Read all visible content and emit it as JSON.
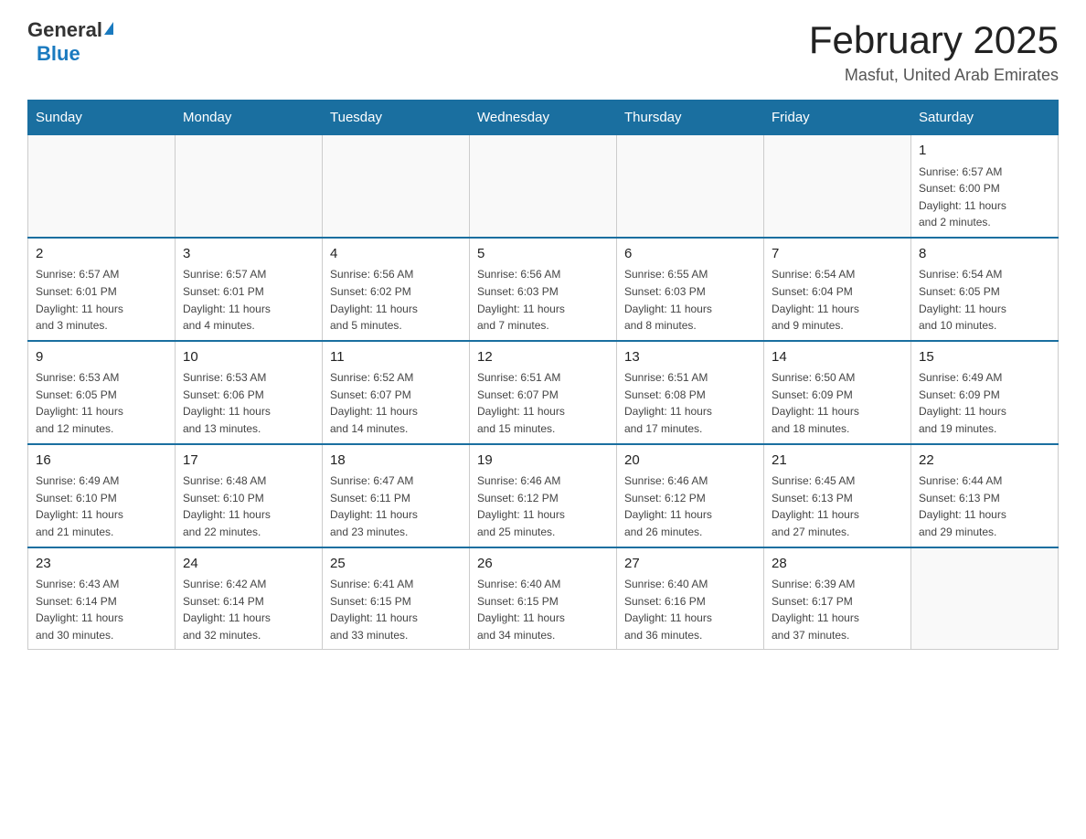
{
  "header": {
    "logo": {
      "general": "General",
      "blue": "Blue"
    },
    "title": "February 2025",
    "location": "Masfut, United Arab Emirates"
  },
  "days_of_week": [
    "Sunday",
    "Monday",
    "Tuesday",
    "Wednesday",
    "Thursday",
    "Friday",
    "Saturday"
  ],
  "weeks": [
    [
      {
        "day": "",
        "info": ""
      },
      {
        "day": "",
        "info": ""
      },
      {
        "day": "",
        "info": ""
      },
      {
        "day": "",
        "info": ""
      },
      {
        "day": "",
        "info": ""
      },
      {
        "day": "",
        "info": ""
      },
      {
        "day": "1",
        "info": "Sunrise: 6:57 AM\nSunset: 6:00 PM\nDaylight: 11 hours\nand 2 minutes."
      }
    ],
    [
      {
        "day": "2",
        "info": "Sunrise: 6:57 AM\nSunset: 6:01 PM\nDaylight: 11 hours\nand 3 minutes."
      },
      {
        "day": "3",
        "info": "Sunrise: 6:57 AM\nSunset: 6:01 PM\nDaylight: 11 hours\nand 4 minutes."
      },
      {
        "day": "4",
        "info": "Sunrise: 6:56 AM\nSunset: 6:02 PM\nDaylight: 11 hours\nand 5 minutes."
      },
      {
        "day": "5",
        "info": "Sunrise: 6:56 AM\nSunset: 6:03 PM\nDaylight: 11 hours\nand 7 minutes."
      },
      {
        "day": "6",
        "info": "Sunrise: 6:55 AM\nSunset: 6:03 PM\nDaylight: 11 hours\nand 8 minutes."
      },
      {
        "day": "7",
        "info": "Sunrise: 6:54 AM\nSunset: 6:04 PM\nDaylight: 11 hours\nand 9 minutes."
      },
      {
        "day": "8",
        "info": "Sunrise: 6:54 AM\nSunset: 6:05 PM\nDaylight: 11 hours\nand 10 minutes."
      }
    ],
    [
      {
        "day": "9",
        "info": "Sunrise: 6:53 AM\nSunset: 6:05 PM\nDaylight: 11 hours\nand 12 minutes."
      },
      {
        "day": "10",
        "info": "Sunrise: 6:53 AM\nSunset: 6:06 PM\nDaylight: 11 hours\nand 13 minutes."
      },
      {
        "day": "11",
        "info": "Sunrise: 6:52 AM\nSunset: 6:07 PM\nDaylight: 11 hours\nand 14 minutes."
      },
      {
        "day": "12",
        "info": "Sunrise: 6:51 AM\nSunset: 6:07 PM\nDaylight: 11 hours\nand 15 minutes."
      },
      {
        "day": "13",
        "info": "Sunrise: 6:51 AM\nSunset: 6:08 PM\nDaylight: 11 hours\nand 17 minutes."
      },
      {
        "day": "14",
        "info": "Sunrise: 6:50 AM\nSunset: 6:09 PM\nDaylight: 11 hours\nand 18 minutes."
      },
      {
        "day": "15",
        "info": "Sunrise: 6:49 AM\nSunset: 6:09 PM\nDaylight: 11 hours\nand 19 minutes."
      }
    ],
    [
      {
        "day": "16",
        "info": "Sunrise: 6:49 AM\nSunset: 6:10 PM\nDaylight: 11 hours\nand 21 minutes."
      },
      {
        "day": "17",
        "info": "Sunrise: 6:48 AM\nSunset: 6:10 PM\nDaylight: 11 hours\nand 22 minutes."
      },
      {
        "day": "18",
        "info": "Sunrise: 6:47 AM\nSunset: 6:11 PM\nDaylight: 11 hours\nand 23 minutes."
      },
      {
        "day": "19",
        "info": "Sunrise: 6:46 AM\nSunset: 6:12 PM\nDaylight: 11 hours\nand 25 minutes."
      },
      {
        "day": "20",
        "info": "Sunrise: 6:46 AM\nSunset: 6:12 PM\nDaylight: 11 hours\nand 26 minutes."
      },
      {
        "day": "21",
        "info": "Sunrise: 6:45 AM\nSunset: 6:13 PM\nDaylight: 11 hours\nand 27 minutes."
      },
      {
        "day": "22",
        "info": "Sunrise: 6:44 AM\nSunset: 6:13 PM\nDaylight: 11 hours\nand 29 minutes."
      }
    ],
    [
      {
        "day": "23",
        "info": "Sunrise: 6:43 AM\nSunset: 6:14 PM\nDaylight: 11 hours\nand 30 minutes."
      },
      {
        "day": "24",
        "info": "Sunrise: 6:42 AM\nSunset: 6:14 PM\nDaylight: 11 hours\nand 32 minutes."
      },
      {
        "day": "25",
        "info": "Sunrise: 6:41 AM\nSunset: 6:15 PM\nDaylight: 11 hours\nand 33 minutes."
      },
      {
        "day": "26",
        "info": "Sunrise: 6:40 AM\nSunset: 6:15 PM\nDaylight: 11 hours\nand 34 minutes."
      },
      {
        "day": "27",
        "info": "Sunrise: 6:40 AM\nSunset: 6:16 PM\nDaylight: 11 hours\nand 36 minutes."
      },
      {
        "day": "28",
        "info": "Sunrise: 6:39 AM\nSunset: 6:17 PM\nDaylight: 11 hours\nand 37 minutes."
      },
      {
        "day": "",
        "info": ""
      }
    ]
  ]
}
